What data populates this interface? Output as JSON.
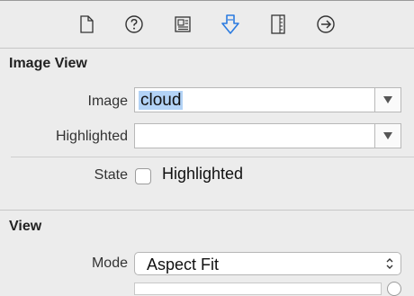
{
  "toolbar": {
    "icons": [
      "file-icon",
      "help-icon",
      "identity-icon",
      "attributes-icon",
      "size-icon",
      "connections-icon"
    ],
    "active_icon": "attributes-icon",
    "accent_color": "#2b7be0"
  },
  "image_view": {
    "title": "Image View",
    "image_label": "Image",
    "image_value": "cloud",
    "highlighted_label": "Highlighted",
    "highlighted_value": "",
    "state_label": "State",
    "state_checkbox_label": "Highlighted",
    "state_checked": false
  },
  "view": {
    "title": "View",
    "mode_label": "Mode",
    "mode_value": "Aspect Fit"
  }
}
